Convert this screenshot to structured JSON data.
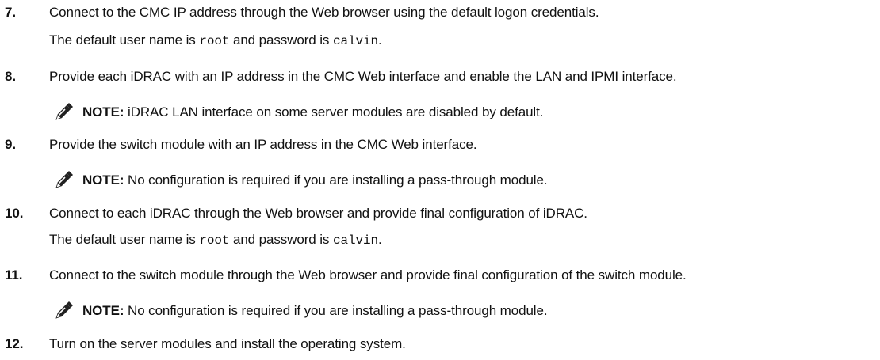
{
  "steps": [
    {
      "number": "7.",
      "text": "Connect to the CMC IP address through the Web browser using the default logon credentials.",
      "detail": {
        "prefix": "The default user name is ",
        "user": "root",
        "middle": " and password is ",
        "password": "calvin",
        "suffix": "."
      }
    },
    {
      "number": "8.",
      "text": "Provide each iDRAC with an IP address in the CMC Web interface and enable the LAN and IPMI interface.",
      "note": {
        "label": "NOTE:",
        "text": " iDRAC LAN interface on some server modules are disabled by default."
      }
    },
    {
      "number": "9.",
      "text": "Provide the switch module with an IP address in the CMC Web interface.",
      "note": {
        "label": "NOTE:",
        "text": " No configuration is required if you are installing a pass-through module."
      }
    },
    {
      "number": "10.",
      "text": "Connect to each iDRAC through the Web browser and provide final configuration of iDRAC.",
      "detail": {
        "prefix": "The default user name is ",
        "user": "root",
        "middle": " and password is ",
        "password": "calvin",
        "suffix": "."
      }
    },
    {
      "number": "11.",
      "text": "Connect to the switch module through the Web browser and provide final configuration of the switch module.",
      "note": {
        "label": "NOTE:",
        "text": " No configuration is required if you are installing a pass-through module."
      }
    },
    {
      "number": "12.",
      "text": "Turn on the server modules and install the operating system."
    }
  ],
  "icons": {
    "note": "pencil-note-icon"
  }
}
